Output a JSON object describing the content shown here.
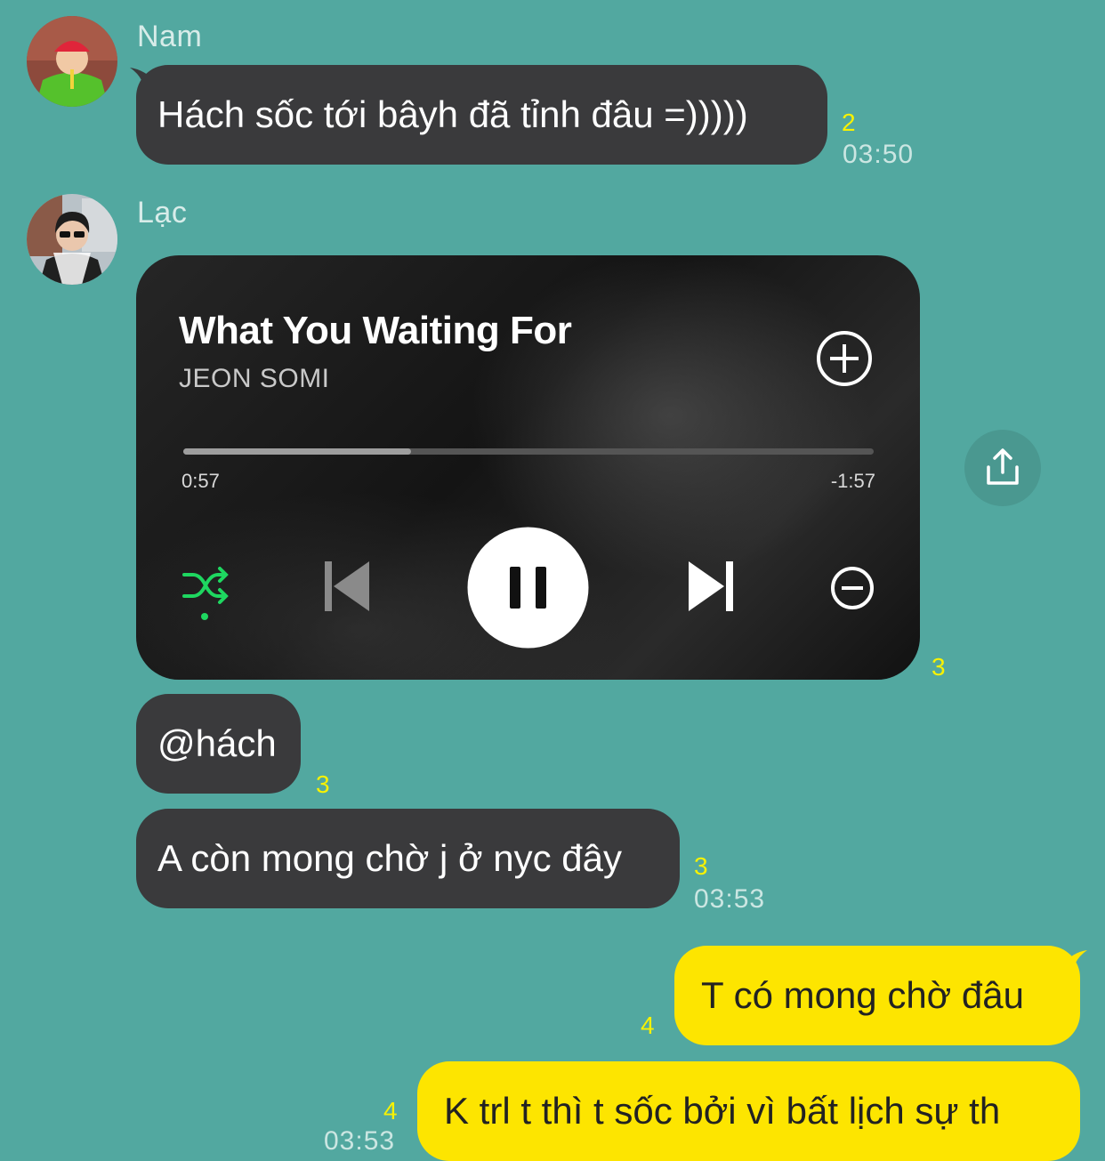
{
  "messages": {
    "nam": {
      "sender": "Nam",
      "text": "Hách sốc tới bâyh đã tỉnh đâu =)))))",
      "unread": "2",
      "time": "03:50"
    },
    "lac": {
      "sender": "Lạc",
      "player": {
        "title": "What You Waiting For",
        "artist": "JEON SOMI",
        "elapsed": "0:57",
        "remaining": "-1:57",
        "progress_fraction": 0.33,
        "unread": "3",
        "shuffle_color": "#1ed760"
      },
      "m2": {
        "text": "@hách",
        "unread": "3"
      },
      "m3": {
        "text": "A còn mong chờ j ở nyc đây",
        "unread": "3",
        "time": "03:53"
      }
    },
    "me": {
      "m1": {
        "text": "T có mong chờ đâu",
        "unread": "4"
      },
      "m2": {
        "text": "K trl t thì t sốc bởi vì bất lịch sự th",
        "unread": "4",
        "time": "03:53"
      }
    }
  },
  "icons": {
    "share": "share-icon",
    "add": "plus-circle-icon",
    "remove": "minus-circle-icon",
    "shuffle": "shuffle-icon",
    "previous": "skip-previous-icon",
    "pause": "pause-icon",
    "next": "skip-next-icon"
  }
}
